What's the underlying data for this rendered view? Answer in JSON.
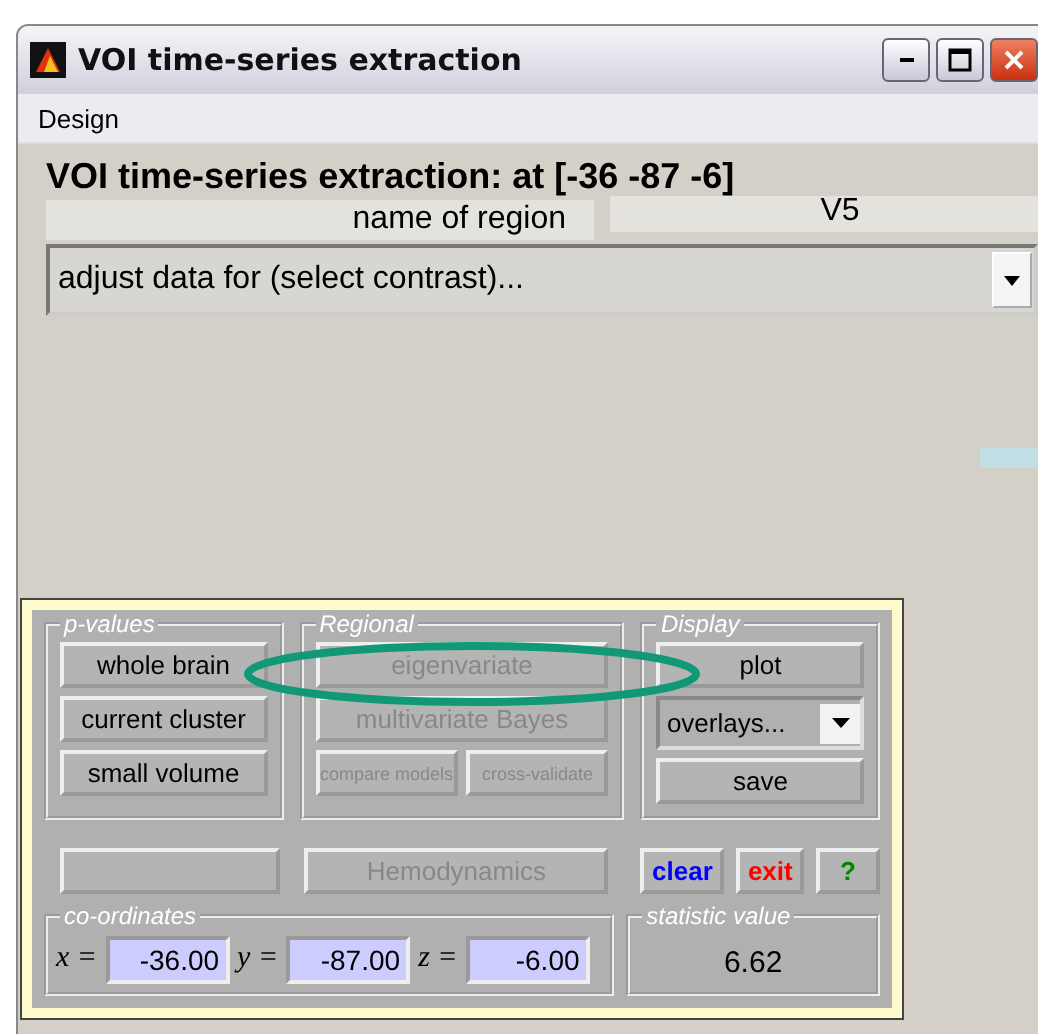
{
  "window": {
    "title": "VOI time-series extraction"
  },
  "menu": [
    "Design"
  ],
  "heading": "VOI time-series extraction: at [-36 -87 -6]",
  "region": {
    "label": "name of region",
    "value": "V5"
  },
  "contrast_select": {
    "value": "adjust data for (select contrast)..."
  },
  "p_values": {
    "title": "p-values",
    "buttons": [
      {
        "label": "whole brain",
        "disabled": false
      },
      {
        "label": "current cluster",
        "disabled": false
      },
      {
        "label": "small volume",
        "disabled": false
      }
    ]
  },
  "regional": {
    "title": "Regional",
    "buttons": [
      {
        "label": "eigenvariate",
        "disabled": true
      },
      {
        "label": "multivariate Bayes",
        "disabled": true
      }
    ],
    "small_buttons": [
      {
        "label": "compare models",
        "disabled": true
      },
      {
        "label": "cross-validate",
        "disabled": true
      }
    ]
  },
  "display": {
    "title": "Display",
    "plot": {
      "label": "plot",
      "disabled": false
    },
    "overlays": {
      "value": "overlays..."
    },
    "save": {
      "label": "save",
      "disabled": false
    }
  },
  "hemodynamics": {
    "label": "Hemodynamics",
    "disabled": true
  },
  "actions": [
    {
      "label": "clear",
      "color": "#0000ff"
    },
    {
      "label": "exit",
      "color": "#ff0000"
    },
    {
      "label": "?",
      "color": "#008800"
    }
  ],
  "coordinates": {
    "title": "co-ordinates",
    "fields": [
      {
        "label": "x =",
        "value": "-36.00"
      },
      {
        "label": "y =",
        "value": "-87.00"
      },
      {
        "label": "z =",
        "value": "-6.00"
      }
    ]
  },
  "statistic": {
    "title": "statistic value",
    "value": "6.62"
  }
}
